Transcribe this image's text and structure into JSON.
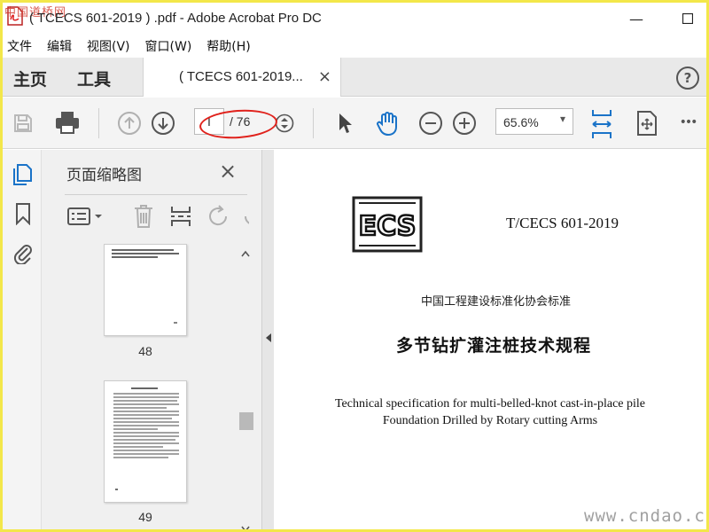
{
  "window": {
    "title": "( TCECS 601-2019 ) .pdf - Adobe Acrobat Pro DC",
    "corner_watermark": "中国道桥网",
    "minimize": "—",
    "maximize": "☐"
  },
  "menu": {
    "items": [
      "文件",
      "编辑",
      "视图(V)",
      "窗口(W)",
      "帮助(H)"
    ]
  },
  "tabs": {
    "home": "主页",
    "tools": "工具",
    "document": "( TCECS 601-2019...",
    "close": "×",
    "help": "?"
  },
  "toolbar": {
    "current_page": "I",
    "total_pages": "/ 76",
    "zoom": "65.6%",
    "zoom_caret": "▾",
    "more": "•••"
  },
  "thumb_panel": {
    "title": "页面缩略图",
    "close": "×",
    "pages": [
      {
        "label": "48"
      },
      {
        "label": "49"
      }
    ]
  },
  "document": {
    "standard_code": "T/CECS 601-2019",
    "association": "中国工程建设标准化协会标准",
    "title_cn": "多节钻扩灌注桩技术规程",
    "title_en_line1": "Technical specification for multi-belled-knot cast-in-place pile",
    "title_en_line2": "Foundation Drilled by Rotary cutting Arms",
    "logo_text": "ECS"
  },
  "footer_watermark": "www.cndao.com",
  "colors": {
    "accent_blue": "#1a73c8",
    "highlight_red": "#e0221c",
    "frame_yellow": "#f3e74a"
  }
}
